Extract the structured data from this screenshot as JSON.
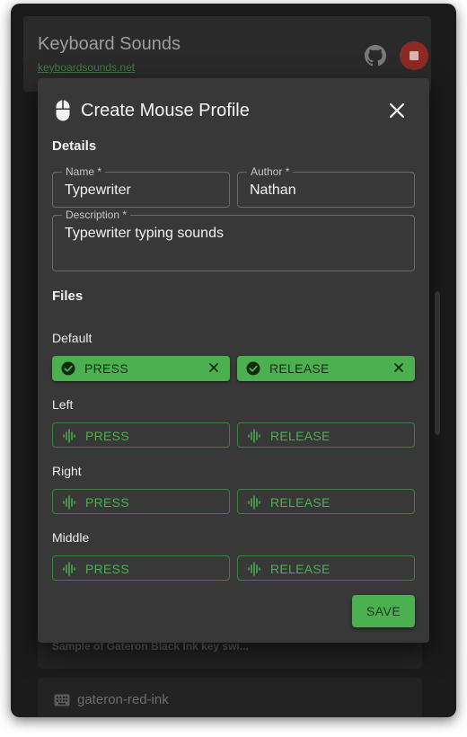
{
  "app": {
    "title": "Keyboard Sounds",
    "link": "keyboardsounds.net",
    "icons": {
      "github": "github-icon",
      "stop": "stop-icon"
    }
  },
  "background": {
    "card1_desc": "Sample of Gateron Black Ink key swi...",
    "card2_name": "gateron-red-ink"
  },
  "dialog": {
    "title": "Create Mouse Profile",
    "icons": {
      "header": "mouse-icon",
      "close": "close-icon"
    },
    "details_heading": "Details",
    "fields": {
      "name": {
        "label": "Name *",
        "value": "Typewriter"
      },
      "author": {
        "label": "Author *",
        "value": "Nathan"
      },
      "description": {
        "label": "Description *",
        "value": "Typewriter typing sounds"
      }
    },
    "files_heading": "Files",
    "groups": [
      {
        "label": "Default",
        "press": "PRESS",
        "release": "RELEASE",
        "press_selected": true,
        "release_selected": true
      },
      {
        "label": "Left",
        "press": "PRESS",
        "release": "RELEASE",
        "press_selected": false,
        "release_selected": false
      },
      {
        "label": "Right",
        "press": "PRESS",
        "release": "RELEASE",
        "press_selected": false,
        "release_selected": false
      },
      {
        "label": "Middle",
        "press": "PRESS",
        "release": "RELEASE",
        "press_selected": false,
        "release_selected": false
      }
    ],
    "save_label": "SAVE"
  },
  "colors": {
    "accent": "#4caf50",
    "stop": "#8d2a24",
    "dialog_bg": "#383838",
    "app_bg": "#1b1b1b"
  }
}
